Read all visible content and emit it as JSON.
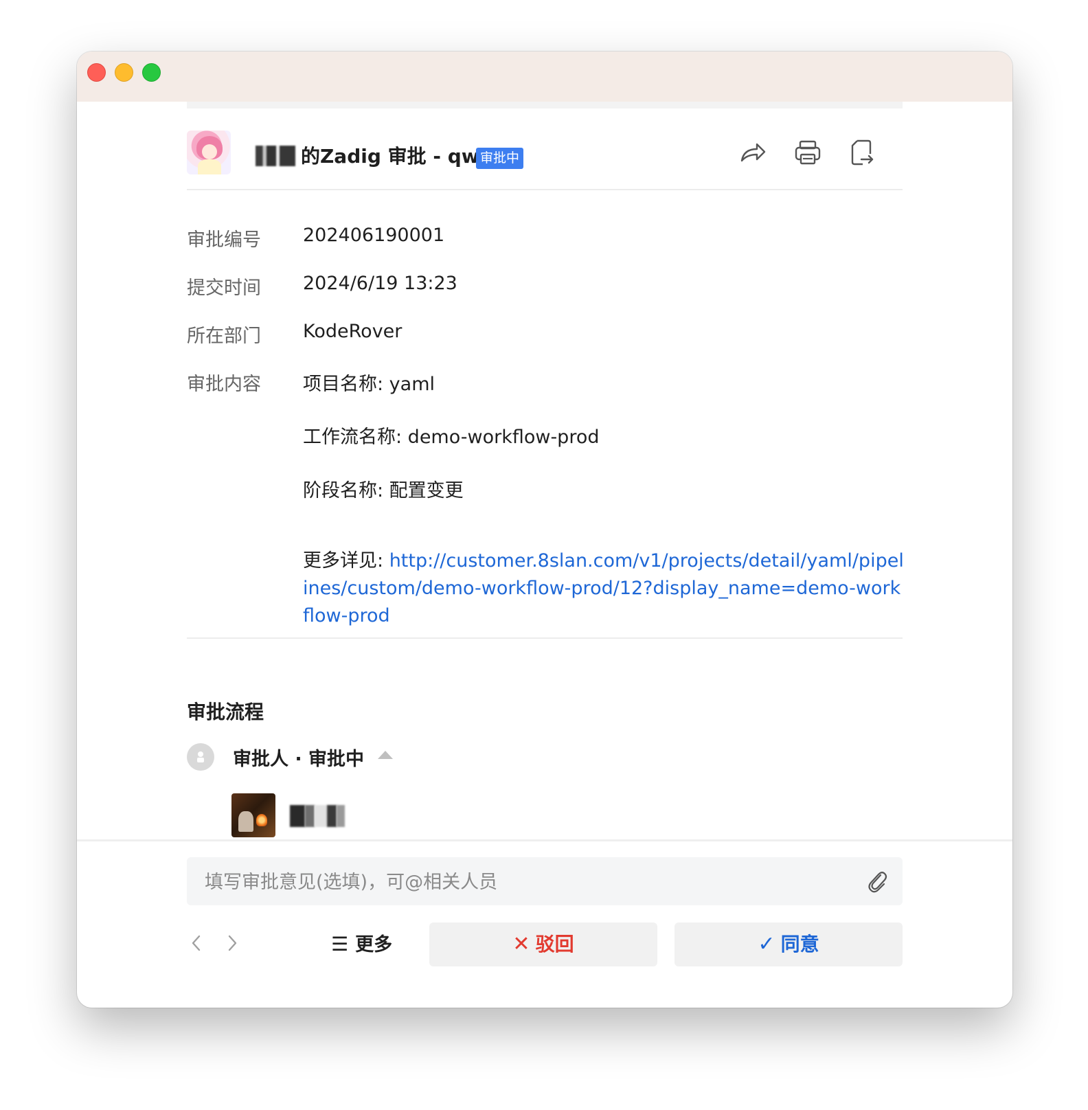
{
  "header": {
    "title_suffix": "的Zadig 审批 - qw",
    "status": "审批中",
    "icons": [
      "share-icon",
      "print-icon",
      "export-icon"
    ]
  },
  "fields": {
    "approval_number": {
      "label": "审批编号",
      "value": "202406190001"
    },
    "submit_time": {
      "label": "提交时间",
      "value": "2024/6/19 13:23"
    },
    "department": {
      "label": "所在部门",
      "value": "KodeRover"
    },
    "content": {
      "label": "审批内容",
      "project_name": "项目名称: yaml",
      "workflow_name": "工作流名称: demo-workflow-prod",
      "stage_name": "阶段名称: 配置变更",
      "more_details_label": "更多详见: ",
      "more_details_link": "http://customer.8slan.com/v1/projects/detail/yaml/pipelines/custom/demo-workflow-prod/12?display_name=demo-workflow-prod"
    }
  },
  "process": {
    "title": "审批流程",
    "step_label": "审批人 · 审批中"
  },
  "footer": {
    "comment_placeholder": "填写审批意见(选填)，可@相关人员",
    "more_label": "更多",
    "more_glyph": "☰",
    "reject_label": "驳回",
    "agree_label": "同意"
  },
  "colors": {
    "accent_blue": "#1e67d6",
    "badge_blue": "#3d7ef0",
    "reject_red": "#e23a2f",
    "titlebar": "#f4ebe6"
  }
}
